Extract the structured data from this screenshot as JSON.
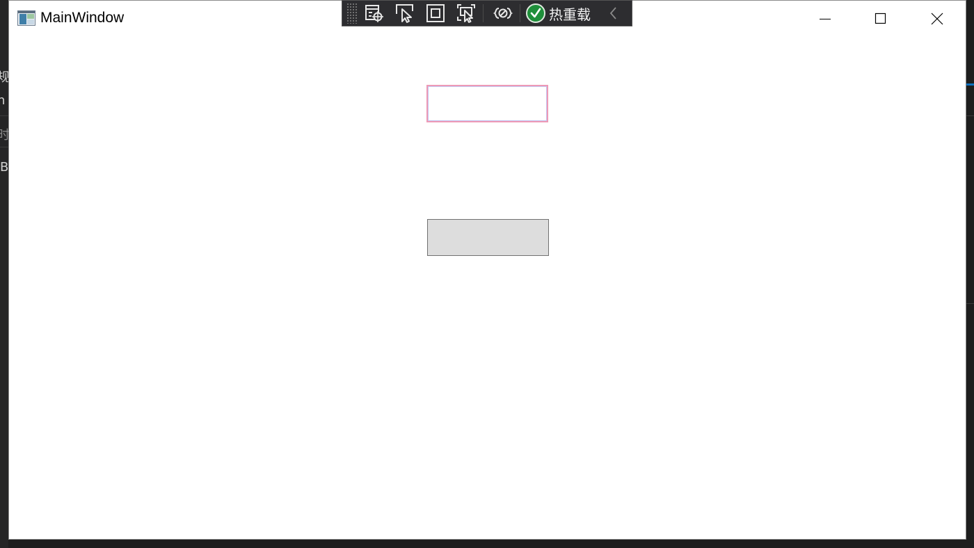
{
  "window": {
    "title": "MainWindow"
  },
  "caption_buttons": {
    "minimize_icon": "minimize-icon",
    "maximize_icon": "maximize-icon",
    "close_icon": "close-icon"
  },
  "debug_toolbar": {
    "tools": [
      {
        "icon": "visual-tree-icon"
      },
      {
        "icon": "select-element-icon"
      },
      {
        "icon": "display-adorners-icon"
      },
      {
        "icon": "track-focus-icon"
      },
      {
        "icon": "binding-failures-icon"
      }
    ],
    "hot_reload": {
      "label": "热重载",
      "status_icon": "check-circle-icon",
      "status_color": "#1e8f3a"
    }
  },
  "main": {
    "textbox": {
      "value": ""
    },
    "button": {
      "label": ""
    }
  },
  "background_ide": {
    "fragments": [
      "规",
      "n",
      "时",
      "B"
    ]
  }
}
